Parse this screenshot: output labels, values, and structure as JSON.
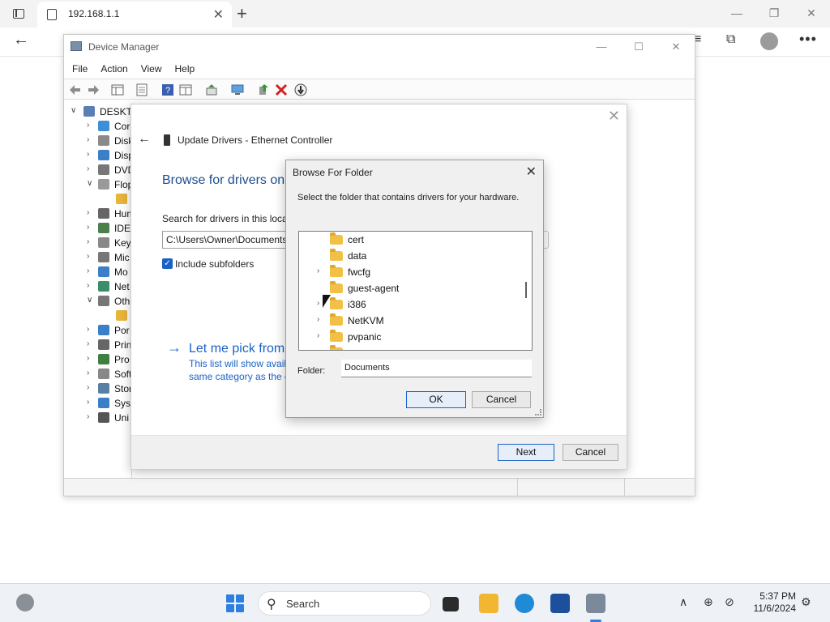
{
  "browser": {
    "tab_title": "192.168.1.1",
    "tab_close": "✕",
    "new_tab": "+",
    "window_controls": [
      "—",
      "❐",
      "✕"
    ],
    "back": "←",
    "menu_dots": "•••"
  },
  "device_manager": {
    "title": "Device Manager",
    "window_controls": [
      "—",
      "☐",
      "✕"
    ],
    "menu": [
      "File",
      "Action",
      "View",
      "Help"
    ],
    "tree": [
      {
        "twisty": "∨",
        "label": "DESKTO",
        "icon_color": "#5a7fb5",
        "level": 0
      },
      {
        "twisty": "›",
        "label": "Cor",
        "icon_color": "#3f8fd6",
        "level": 1
      },
      {
        "twisty": "›",
        "label": "Disk",
        "icon_color": "#8a8a8a",
        "level": 1
      },
      {
        "twisty": "›",
        "label": "Disp",
        "icon_color": "#3a7fc7",
        "level": 1
      },
      {
        "twisty": "›",
        "label": "DVD",
        "icon_color": "#777777",
        "level": 1
      },
      {
        "twisty": "∨",
        "label": "Flop",
        "icon_color": "#999999",
        "level": 1
      },
      {
        "twisty": "",
        "label": "",
        "icon_color": "#e8b43a",
        "level": 2
      },
      {
        "twisty": "›",
        "label": "Hum",
        "icon_color": "#666666",
        "level": 1
      },
      {
        "twisty": "›",
        "label": "IDE",
        "icon_color": "#4d7f4d",
        "level": 1
      },
      {
        "twisty": "›",
        "label": "Key",
        "icon_color": "#888888",
        "level": 1
      },
      {
        "twisty": "›",
        "label": "Mic",
        "icon_color": "#777777",
        "level": 1
      },
      {
        "twisty": "›",
        "label": "Mo",
        "icon_color": "#3a7fc7",
        "level": 1
      },
      {
        "twisty": "›",
        "label": "Net",
        "icon_color": "#3a8f6a",
        "level": 1
      },
      {
        "twisty": "∨",
        "label": "Oth",
        "icon_color": "#777777",
        "level": 1
      },
      {
        "twisty": "",
        "label": "",
        "icon_color": "#e8b43a",
        "level": 2
      },
      {
        "twisty": "›",
        "label": "Por",
        "icon_color": "#3a7fc7",
        "level": 1
      },
      {
        "twisty": "›",
        "label": "Prin",
        "icon_color": "#666666",
        "level": 1
      },
      {
        "twisty": "›",
        "label": "Pro",
        "icon_color": "#3f7f3f",
        "level": 1
      },
      {
        "twisty": "›",
        "label": "Soft",
        "icon_color": "#888888",
        "level": 1
      },
      {
        "twisty": "›",
        "label": "Stor",
        "icon_color": "#5a7fa5",
        "level": 1
      },
      {
        "twisty": "›",
        "label": "Syst",
        "icon_color": "#3a7fc7",
        "level": 1
      },
      {
        "twisty": "›",
        "label": "Uni",
        "icon_color": "#555555",
        "level": 1
      }
    ]
  },
  "wizard": {
    "close": "✕",
    "back": "←",
    "title": "Update Drivers - Ethernet Controller",
    "heading": "Browse for drivers on",
    "search_label": "Search for drivers in this locat",
    "path_value": "C:\\Users\\Owner\\Documents",
    "include_subfolders": "Include subfolders",
    "pick_arrow": "→",
    "pick_title": "Let me pick from",
    "pick_desc_1": "This list will show avail",
    "pick_desc_2": "same category as the d",
    "next": "Next",
    "cancel": "Cancel"
  },
  "browse_folder": {
    "title": "Browse For Folder",
    "close": "✕",
    "description": "Select the folder that contains drivers for your hardware.",
    "folders": [
      {
        "name": "cert",
        "expandable": false
      },
      {
        "name": "data",
        "expandable": false
      },
      {
        "name": "fwcfg",
        "expandable": true
      },
      {
        "name": "guest-agent",
        "expandable": false
      },
      {
        "name": "i386",
        "expandable": true
      },
      {
        "name": "NetKVM",
        "expandable": true
      },
      {
        "name": "pvpanic",
        "expandable": true
      }
    ],
    "folder_label": "Folder:",
    "folder_value": "Documents",
    "ok": "OK",
    "cancel": "Cancel"
  },
  "taskbar": {
    "search_placeholder": "Search",
    "time": "5:37 PM",
    "date": "11/6/2024",
    "tray_chevron": "∧"
  },
  "colors": {
    "accent": "#1b62c6",
    "folder": "#f1c146",
    "taskbar": "#eef2f7"
  }
}
